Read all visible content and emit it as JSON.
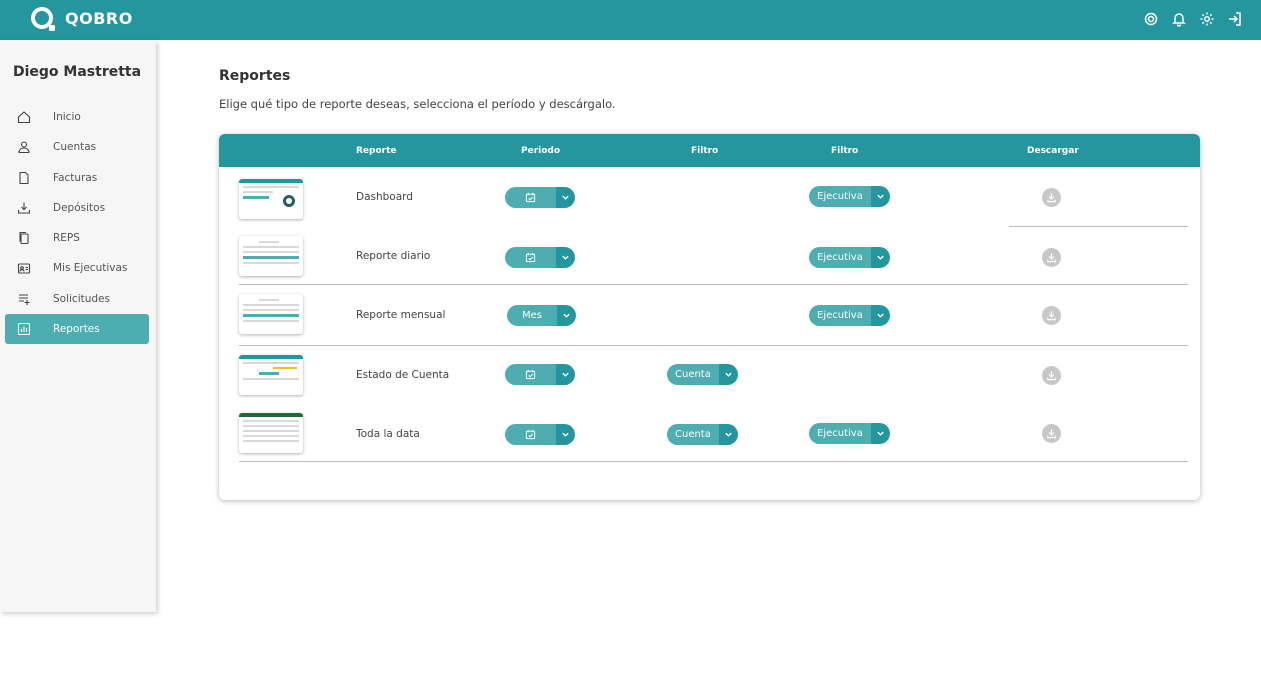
{
  "app": {
    "brand": "QOBRO"
  },
  "topbar": {
    "icons": [
      "support-icon",
      "bell-icon",
      "gear-icon",
      "logout-icon"
    ]
  },
  "sidebar": {
    "user_name": "Diego Mastretta",
    "items": [
      {
        "label": "Inicio",
        "icon": "home-icon"
      },
      {
        "label": "Cuentas",
        "icon": "user-icon"
      },
      {
        "label": "Facturas",
        "icon": "document-icon"
      },
      {
        "label": "Depósitos",
        "icon": "tray-download-icon"
      },
      {
        "label": "REPS",
        "icon": "copy-icon"
      },
      {
        "label": "Mis Ejecutivas",
        "icon": "id-card-icon"
      },
      {
        "label": "Solicitudes",
        "icon": "list-add-icon"
      },
      {
        "label": "Reportes",
        "icon": "chart-icon",
        "active": true
      }
    ]
  },
  "main": {
    "title": "Reportes",
    "description": "Elige qué tipo de reporte deseas, selecciona el período y descárgalo."
  },
  "table": {
    "headers": {
      "reporte": "Reporte",
      "periodo": "Periodo",
      "filtro1": "Filtro",
      "filtro2": "Filtro",
      "descargar": "Descargar"
    },
    "rows": [
      {
        "name": "Dashboard",
        "periodo": "",
        "cuenta": null,
        "ejecutiva": "Ejecutiva"
      },
      {
        "name": "Reporte diario",
        "periodo": "",
        "cuenta": null,
        "ejecutiva": "Ejecutiva"
      },
      {
        "name": "Reporte mensual",
        "periodo": "Mes",
        "cuenta": null,
        "ejecutiva": "Ejecutiva"
      },
      {
        "name": "Estado de Cuenta",
        "periodo": "",
        "cuenta": "Cuenta",
        "ejecutiva": null
      },
      {
        "name": "Toda la data",
        "periodo": "",
        "cuenta": "Cuenta",
        "ejecutiva": "Ejecutiva"
      }
    ]
  },
  "colors": {
    "primary": "#25969d",
    "primary_light": "#4eadb1",
    "disabled": "#c8c8c8"
  }
}
